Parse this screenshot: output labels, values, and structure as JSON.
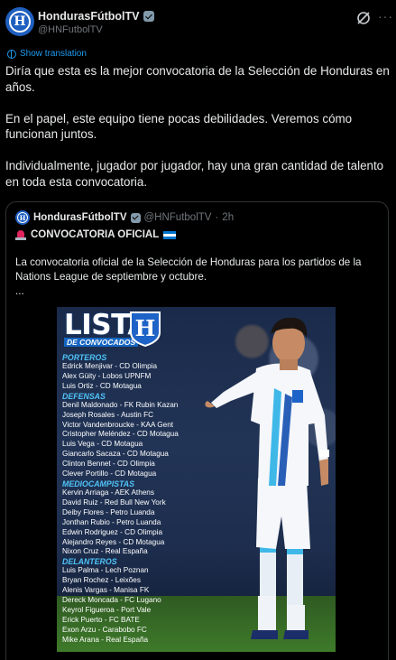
{
  "account": {
    "name": "HondurasFútbolTV",
    "handle": "@HNFutbolTV",
    "avatar_letter": "H"
  },
  "icons": {
    "verified": "verified-badge-icon",
    "grok": "grok-icon",
    "more": "more-icon",
    "translate": "translate-icon"
  },
  "tweet": {
    "translate_label": "Show translation",
    "paragraphs": [
      "Diría que esta es la mejor convocatoria de la Selección de Honduras en años.",
      "En el papel, este equipo tiene pocas debilidades. Veremos cómo funcionan juntos.",
      "Individualmente, jugador por jugador, hay una gran cantidad de talento en toda esta convocatoria."
    ]
  },
  "quote": {
    "name": "HondurasFútbolTV",
    "handle": "@HNFutbolTV",
    "separator": "·",
    "time": "2h",
    "headline": "CONVOCATORIA OFICIAL",
    "text": "La convocatoria oficial de la Selección de Honduras para los partidos de la Nations League de septiembre y octubre.",
    "ellipsis": "..."
  },
  "media": {
    "title": "LISTA",
    "subtitle": "DE CONVOCADOS",
    "crest_letter": "H",
    "sections": [
      {
        "name": "PORTEROS",
        "players": [
          "Edrick Menjivar - CD Olimpia",
          "Alex Güity - Lobos UPNFM",
          "Luis Ortiz - CD Motagua"
        ]
      },
      {
        "name": "DEFENSAS",
        "players": [
          "Denil Maldonado - FK Rubin Kazan",
          "Joseph Rosales - Austin FC",
          "Victor Vandenbroucke - KAA Gent",
          "Cristopher Meléndez - CD Motagua",
          "Luis Vega - CD Motagua",
          "Giancarlo Sacaza - CD Motagua",
          "Clinton Bennet - CD Olimpia",
          "Clever Portillo - CD Motagua"
        ]
      },
      {
        "name": "MEDIOCAMPISTAS",
        "players": [
          "Kervin Arriaga - AEK Athens",
          "David Ruiz - Red Bull New York",
          "Deiby Flores - Petro Luanda",
          "Jonthan Rubio - Petro Luanda",
          "Edwin Rodriguez - CD Olimpia",
          "Alejandro Reyes - CD Motagua",
          "Nixon Cruz - Real España"
        ]
      },
      {
        "name": "DELANTEROS",
        "players": [
          "Luis Palma - Lech Poznan",
          "Bryan Rochez - Leixões",
          "Alenis Vargas - Manisa FK",
          "Dereck Moncada - FC Lugano",
          "Keyrol Figueroa - Port Vale",
          "Erick Puerto - FC BATE",
          "Exon Arzu - Carabobo FC",
          "Mike Arana - Real España"
        ]
      }
    ]
  }
}
